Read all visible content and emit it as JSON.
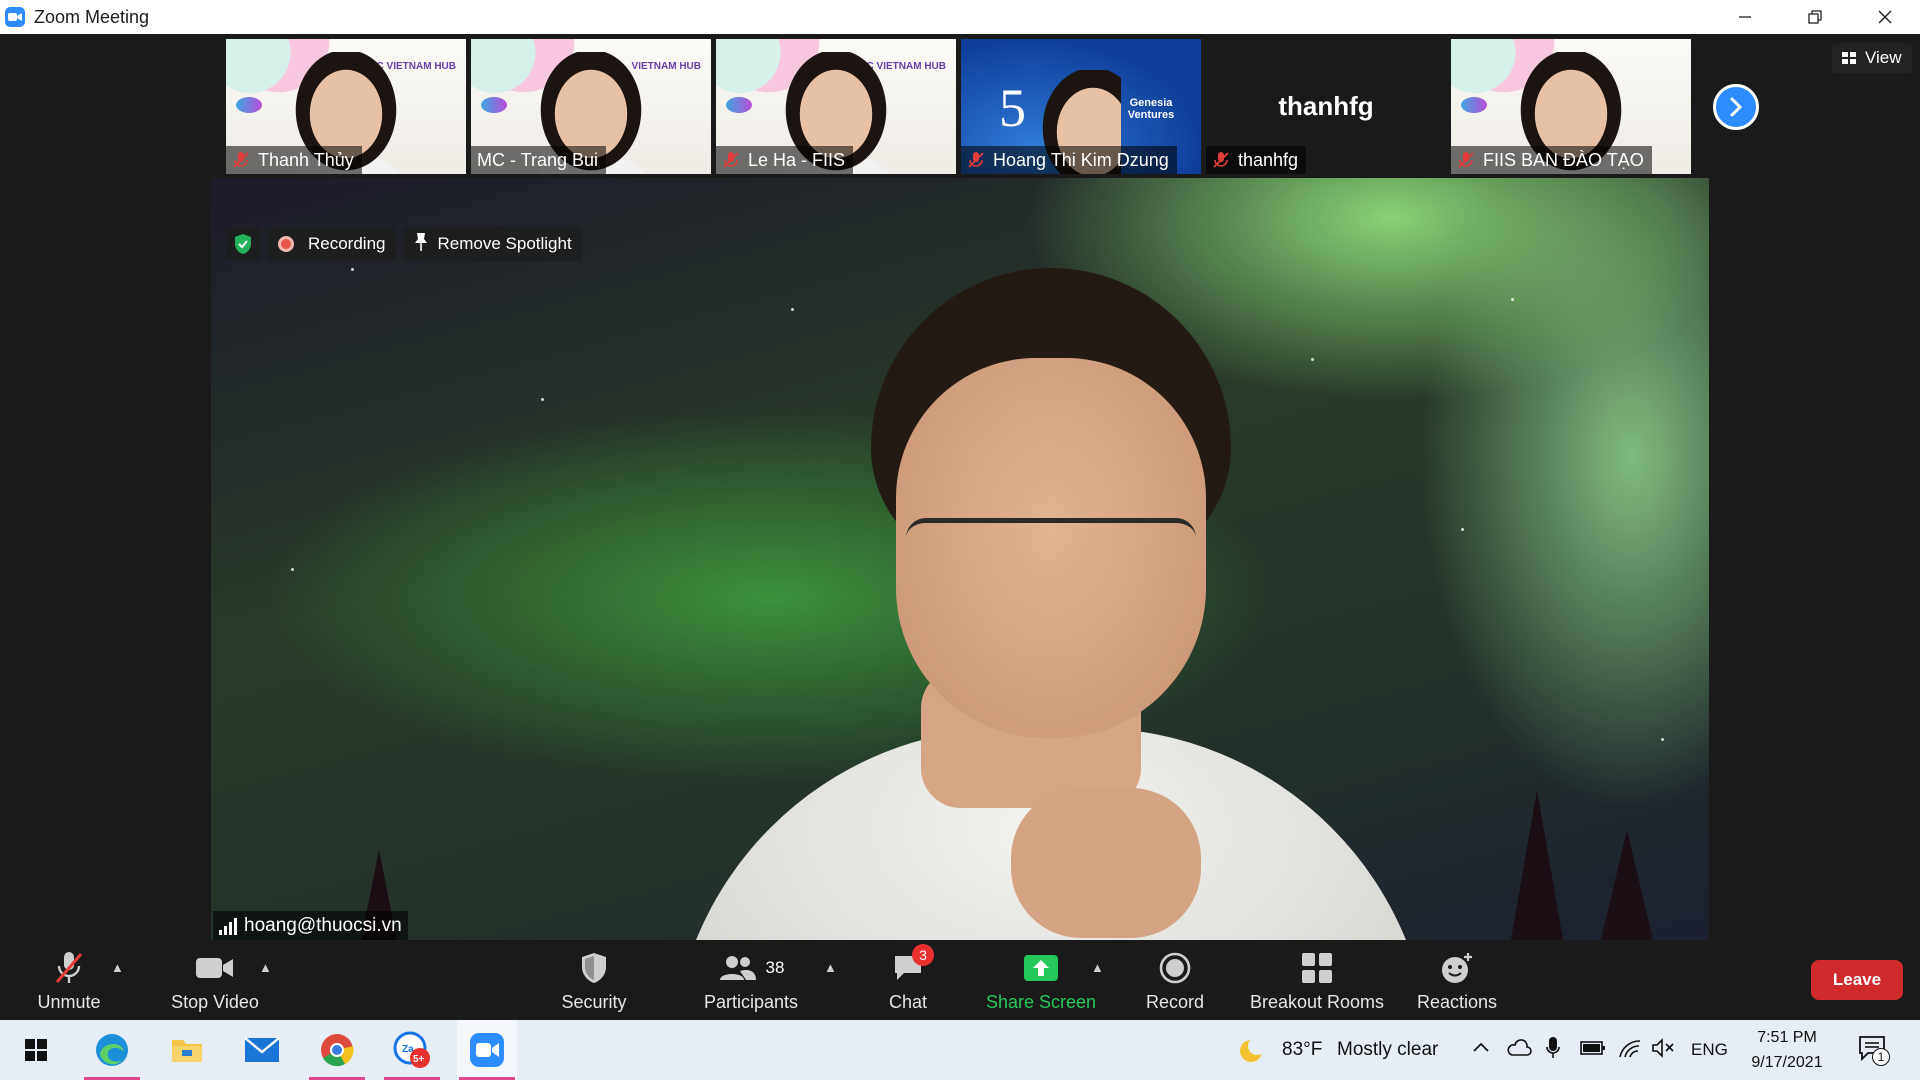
{
  "window": {
    "title": "Zoom Meeting"
  },
  "thumbnails": [
    {
      "name": "Thanh Thủy",
      "hub": "SBC VIETNAM HUB"
    },
    {
      "name": "MC - Trang Bui",
      "hub": "VIETNAM HUB"
    },
    {
      "name": "Le Ha - FIIS",
      "hub": "C VIETNAM HUB"
    },
    {
      "name": "Hoang Thi Kim Dzung",
      "logo_num": "5",
      "logo_text": "Genesia Ventures"
    },
    {
      "name": "thanhfg",
      "display": "thanhfg"
    },
    {
      "name": "FIIS BAN ĐÀO TẠO"
    }
  ],
  "view_button": "View",
  "top_badges": {
    "recording": "Recording",
    "remove_spotlight": "Remove Spotlight"
  },
  "active_speaker": {
    "name": "hoang@thuocsi.vn"
  },
  "toolbar": {
    "unmute": "Unmute",
    "stop_video": "Stop Video",
    "security": "Security",
    "participants": "Participants",
    "participants_count": "38",
    "chat": "Chat",
    "chat_badge": "3",
    "share_screen": "Share Screen",
    "record": "Record",
    "breakout_rooms": "Breakout Rooms",
    "reactions": "Reactions",
    "leave": "Leave"
  },
  "taskbar": {
    "weather_temp": "83°F",
    "weather_text": "Mostly clear",
    "lang": "ENG",
    "time": "7:51 PM",
    "date": "9/17/2021",
    "zalo_badge": "5+",
    "notification_count": "1"
  },
  "colors": {
    "accent_blue": "#2D8CFF",
    "share_green": "#24c95a",
    "leave_red": "#d12a2a",
    "chat_badge_red": "#e8312f"
  }
}
